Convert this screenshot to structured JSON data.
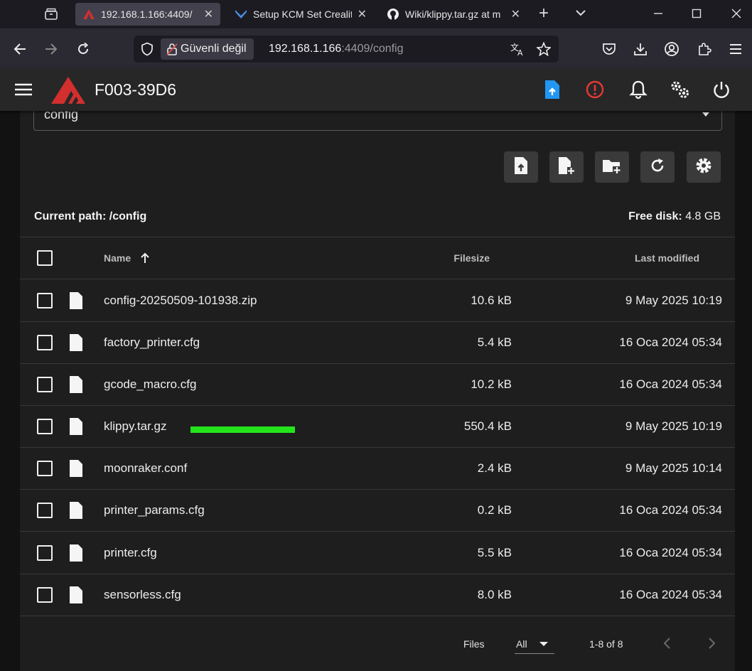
{
  "browser": {
    "tabs": [
      {
        "title": "192.168.1.166:4409/",
        "active": true
      },
      {
        "title": "Setup KCM Set Crealit",
        "active": false
      },
      {
        "title": "Wiki/klippy.tar.gz at m",
        "active": false
      }
    ],
    "new_tab_label": "+",
    "site_info_label": "Güvenli değil",
    "url_host": "192.168.1.166",
    "url_rest": ":4409/config"
  },
  "app": {
    "title": "F003-39D6",
    "accent_color": "#d32f2f",
    "upload_icon_color": "#2196f3"
  },
  "files": {
    "root_select_value": "config",
    "current_path_label": "Current path:",
    "current_path_value": "/config",
    "free_disk_label": "Free disk:",
    "free_disk_value": "4.8 GB",
    "columns": {
      "name": "Name",
      "filesize": "Filesize",
      "modified": "Last modified"
    },
    "rows": [
      {
        "name": "config-20250509-101938.zip",
        "size": "10.6 kB",
        "modified": "9 May 2025 10:19"
      },
      {
        "name": "factory_printer.cfg",
        "size": "5.4 kB",
        "modified": "16 Oca 2024 05:34"
      },
      {
        "name": "gcode_macro.cfg",
        "size": "10.2 kB",
        "modified": "16 Oca 2024 05:34"
      },
      {
        "name": "klippy.tar.gz",
        "size": "550.4 kB",
        "modified": "9 May 2025 10:19"
      },
      {
        "name": "moonraker.conf",
        "size": "2.4 kB",
        "modified": "9 May 2025 10:14"
      },
      {
        "name": "printer_params.cfg",
        "size": "0.2 kB",
        "modified": "16 Oca 2024 05:34"
      },
      {
        "name": "printer.cfg",
        "size": "5.5 kB",
        "modified": "16 Oca 2024 05:34"
      },
      {
        "name": "sensorless.cfg",
        "size": "8.0 kB",
        "modified": "16 Oca 2024 05:34"
      }
    ],
    "footer": {
      "rows_per_page_label": "Files",
      "rows_per_page_value": "All",
      "page_info": "1-8 of 8"
    },
    "highlight_color": "#23e41b"
  }
}
